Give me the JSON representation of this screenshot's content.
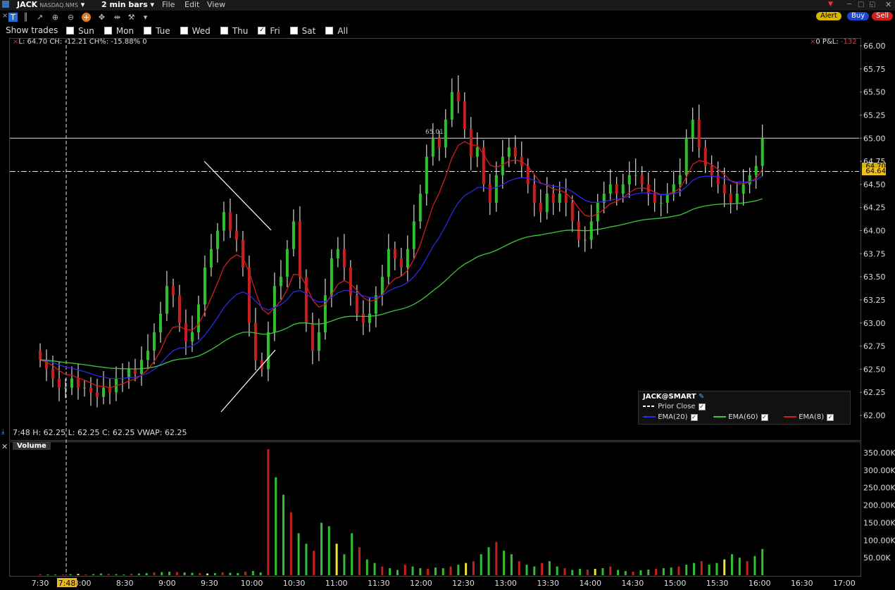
{
  "window": {
    "symbol": "JACK",
    "exchange": "NASDAQ.NMS",
    "bar_size": "2 min bars",
    "menus": [
      "File",
      "Edit",
      "View"
    ],
    "buttons": {
      "alert": "Alert",
      "buy": "Buy",
      "sell": "Sell"
    }
  },
  "trades_filter": {
    "label": "Show trades",
    "days": [
      {
        "label": "Sun",
        "checked": false
      },
      {
        "label": "Mon",
        "checked": false
      },
      {
        "label": "Tue",
        "checked": false
      },
      {
        "label": "Wed",
        "checked": false
      },
      {
        "label": "Thu",
        "checked": false
      },
      {
        "label": "Fri",
        "checked": true
      },
      {
        "label": "Sat",
        "checked": false
      },
      {
        "label": "All",
        "checked": false
      }
    ]
  },
  "readout_top": "L: 64.70 CH: -12.21 CH%: -15.88% 0",
  "pnl_label": "0 P&L:",
  "pnl_value": "-132",
  "readout_bottom": "7:48   H: 62.25 L: 62.25 C: 62.25 VWAP: 62.25",
  "cursor_time": "7:48",
  "volume_title": "Volume",
  "legend": {
    "title": "JACK@SMART",
    "prior_close": "Prior Close",
    "ema20": "EMA(20)",
    "ema60": "EMA(60)",
    "ema8": "EMA(8)"
  },
  "price_tags": {
    "last": "64.70",
    "current": "64.64"
  },
  "colors": {
    "up": "#2fbf2f",
    "down": "#c81e1e",
    "ema20": "#2a2ae8",
    "ema60": "#3cc83c",
    "ema8": "#d01e1e",
    "vwap_volume_highlight": "#e8e830"
  },
  "chart_data": {
    "type": "candlestick",
    "price_axis": {
      "min": 62.0,
      "max": 66.0,
      "ticks": [
        "66.00",
        "65.75",
        "65.50",
        "65.25",
        "65.00",
        "64.75",
        "64.50",
        "64.25",
        "64.00",
        "63.75",
        "63.50",
        "63.25",
        "63.00",
        "62.75",
        "62.50",
        "62.25",
        "62.00"
      ]
    },
    "volume_axis": {
      "ticks": [
        "350.00K",
        "300.00K",
        "250.00K",
        "200.00K",
        "150.00K",
        "100.00K",
        "50.00K"
      ]
    },
    "time_ticks": [
      "7:30",
      "8:00",
      "8:30",
      "9:00",
      "9:30",
      "10:00",
      "10:30",
      "11:00",
      "11:30",
      "12:00",
      "12:30",
      "13:00",
      "13:30",
      "14:00",
      "14:30",
      "15:00",
      "15:30",
      "16:00",
      "16:30",
      "17:00"
    ],
    "reference_lines": {
      "solid": 65.0,
      "dash_dot": 64.64
    },
    "annotation": "65.01",
    "price_series": {
      "time_start": "7:30",
      "bar_minutes": 2,
      "closes": [
        62.6,
        62.5,
        62.4,
        62.3,
        62.3,
        62.4,
        62.3,
        62.3,
        62.25,
        62.2,
        62.3,
        62.25,
        62.4,
        62.4,
        62.5,
        62.45,
        62.6,
        62.7,
        62.9,
        63.1,
        63.4,
        63.3,
        63.0,
        62.8,
        62.9,
        63.2,
        63.6,
        63.8,
        64.0,
        64.2,
        64.0,
        63.9,
        63.6,
        63.0,
        62.6,
        62.5,
        62.9,
        63.4,
        63.5,
        63.8,
        64.1,
        63.5,
        63.0,
        62.7,
        62.9,
        63.3,
        63.7,
        63.8,
        63.6,
        63.3,
        63.1,
        63.0,
        63.1,
        63.3,
        63.5,
        63.8,
        63.7,
        63.6,
        63.8,
        64.1,
        64.4,
        64.8,
        65.0,
        64.9,
        65.2,
        65.5,
        65.4,
        65.1,
        64.8,
        64.9,
        64.5,
        64.3,
        64.6,
        64.8,
        64.9,
        64.8,
        64.7,
        64.5,
        64.3,
        64.2,
        64.4,
        64.3,
        64.4,
        64.3,
        64.1,
        63.9,
        63.9,
        64.1,
        64.3,
        64.4,
        64.5,
        64.4,
        64.5,
        64.6,
        64.6,
        64.5,
        64.4,
        64.3,
        64.3,
        64.4,
        64.5,
        64.6,
        65.0,
        65.2,
        64.9,
        64.7,
        64.6,
        64.5,
        64.4,
        64.3,
        64.4,
        64.5,
        64.6,
        64.7,
        65.0
      ]
    },
    "volume_series": {
      "values": [
        3,
        2,
        2,
        2,
        3,
        4,
        2,
        3,
        5,
        4,
        3,
        2,
        4,
        5,
        6,
        8,
        9,
        10,
        9,
        8,
        7,
        6,
        5,
        6,
        8,
        7,
        6,
        10,
        12,
        8,
        360,
        280,
        230,
        180,
        120,
        90,
        70,
        150,
        140,
        90,
        60,
        120,
        80,
        45,
        35,
        25,
        20,
        15,
        30,
        25,
        20,
        18,
        22,
        20,
        25,
        30,
        35,
        40,
        60,
        80,
        95,
        70,
        60,
        40,
        30,
        25,
        35,
        40,
        25,
        20,
        15,
        18,
        16,
        18,
        20,
        25,
        15,
        12,
        10,
        14,
        16,
        18,
        20,
        22,
        25,
        30,
        35,
        40,
        30,
        35,
        45,
        60,
        50,
        40,
        55,
        75
      ]
    }
  }
}
